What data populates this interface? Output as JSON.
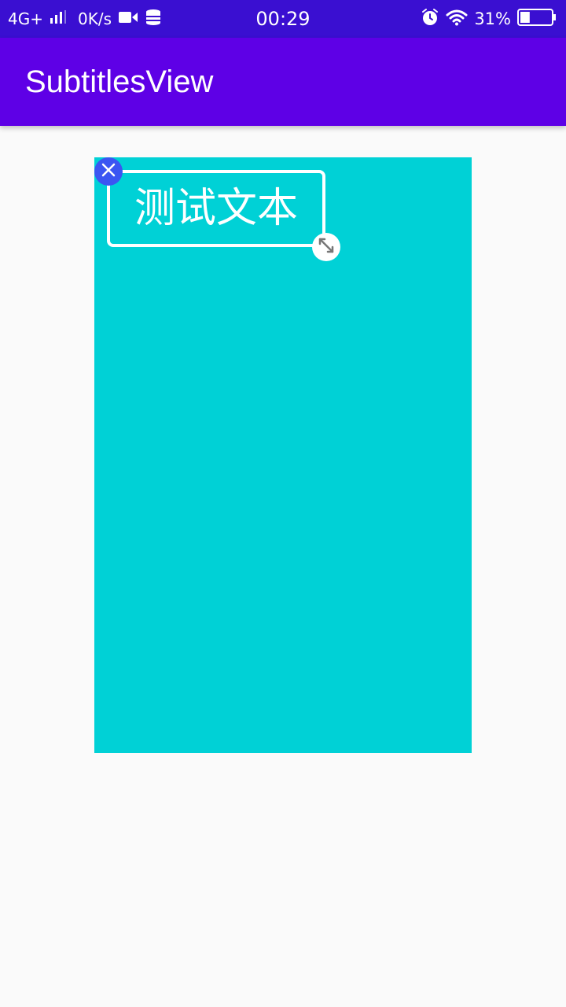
{
  "status_bar": {
    "network": "4G+",
    "speed": "0K/s",
    "time": "00:29",
    "battery": "31%",
    "icons": [
      "signal-icon",
      "video-icon",
      "data-icon",
      "alarm-icon",
      "wifi-icon",
      "battery-icon"
    ],
    "battery_level": 0.31
  },
  "app_bar": {
    "title": "SubtitlesView"
  },
  "canvas": {
    "background": "#00d1d6"
  },
  "subtitle": {
    "text": "测试文本"
  },
  "colors": {
    "status_bar": "#3a0fd1",
    "app_bar": "#5e00e6",
    "delete_handle": "#3b55f2"
  }
}
